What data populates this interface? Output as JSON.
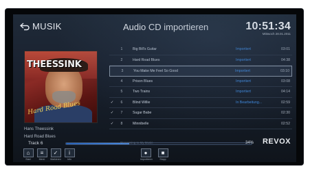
{
  "header": {
    "back_label": "MUSIK",
    "title": "Audio CD importieren",
    "time": "10:51:34",
    "date": "Mittwoch 28.01.2011"
  },
  "album": {
    "cover_title": "THEESSINK",
    "cover_subtitle": "Hard Road Blues",
    "artist": "Hans Theessink",
    "album": "Hard Road Blues"
  },
  "tracks": [
    {
      "check": "",
      "num": "1",
      "title": "Big Bill's Guitar",
      "status": "Importiert",
      "duration": "03:01"
    },
    {
      "check": "",
      "num": "2",
      "title": "Hard Road Blues",
      "status": "Importiert",
      "duration": "04:38"
    },
    {
      "check": "",
      "num": "3",
      "title": "You Make Me Feel So Good",
      "status": "Importiert",
      "duration": "03:10"
    },
    {
      "check": "",
      "num": "4",
      "title": "Prison Blues",
      "status": "Importiert",
      "duration": "03:08"
    },
    {
      "check": "",
      "num": "5",
      "title": "Two Trains",
      "status": "Importiert",
      "duration": "04:14"
    },
    {
      "check": "✓",
      "num": "6",
      "title": "Blind Willie",
      "status": "In Bearbeitung...",
      "duration": "02:59"
    },
    {
      "check": "✓",
      "num": "7",
      "title": "Sugar Babe",
      "status": "",
      "duration": "02:30"
    },
    {
      "check": "✓",
      "num": "8",
      "title": "Minnibelle",
      "status": "",
      "duration": "02:52"
    }
  ],
  "selected_track_index": 2,
  "progress": {
    "track_label": "Track 6",
    "status_text": "Processing to My Music",
    "percent_label": "34%",
    "fraction": 0.34
  },
  "brand": "REVOX",
  "toolbar": {
    "left": [
      {
        "icon": "home-icon",
        "glyph": "⌂",
        "label": "Start"
      },
      {
        "icon": "menu-icon",
        "glyph": "≡",
        "label": "Menü"
      },
      {
        "icon": "check-icon",
        "glyph": "✓",
        "label": "Markieren"
      },
      {
        "icon": "info-icon",
        "glyph": "i",
        "label": "Info"
      }
    ],
    "center": [
      {
        "icon": "record-icon",
        "glyph": "●",
        "label": "Importieren"
      },
      {
        "icon": "stop-icon",
        "glyph": "■",
        "label": "Stopp"
      }
    ]
  },
  "colors": {
    "accent": "#3f8de6",
    "background": "#1a2230"
  }
}
